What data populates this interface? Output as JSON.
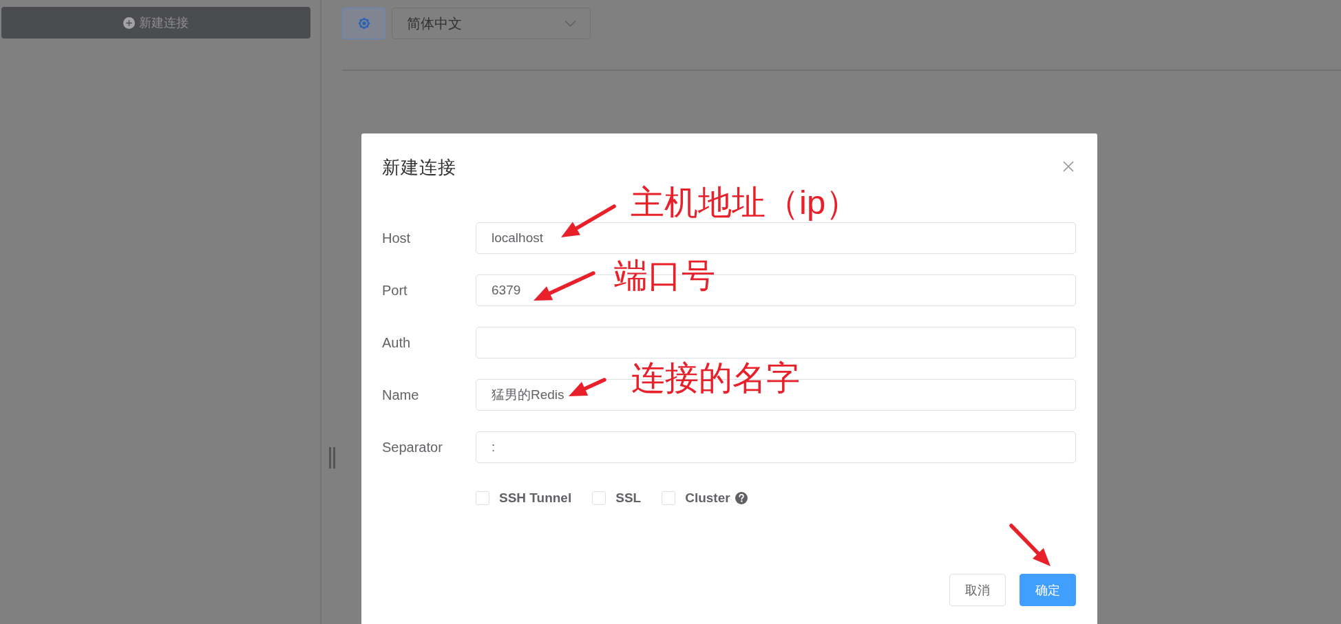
{
  "sidebar": {
    "new_connection_button": "新建连接"
  },
  "toolbar": {
    "language": "简体中文"
  },
  "dialog": {
    "title": "新建连接",
    "fields": [
      {
        "label": "Host",
        "value": "localhost"
      },
      {
        "label": "Port",
        "value": "6379"
      },
      {
        "label": "Auth"
      },
      {
        "label": "Name",
        "value": "猛男的Redis"
      },
      {
        "label": "Separator",
        "value": ":"
      }
    ],
    "options": [
      {
        "label": "SSH Tunnel",
        "checked": false,
        "help": false
      },
      {
        "label": "SSL",
        "checked": false,
        "help": false
      },
      {
        "label": "Cluster",
        "checked": false,
        "help": true
      }
    ],
    "buttons": [
      {
        "label": "取消",
        "kind": "default"
      },
      {
        "label": "确定",
        "kind": "primary"
      }
    ]
  },
  "annotations": [
    {
      "kind": "callout",
      "text": "主机地址（ip）"
    },
    {
      "kind": "callout",
      "text": "端口号"
    },
    {
      "kind": "callout",
      "text": "连接的名字"
    },
    {
      "kind": "arrow"
    }
  ]
}
